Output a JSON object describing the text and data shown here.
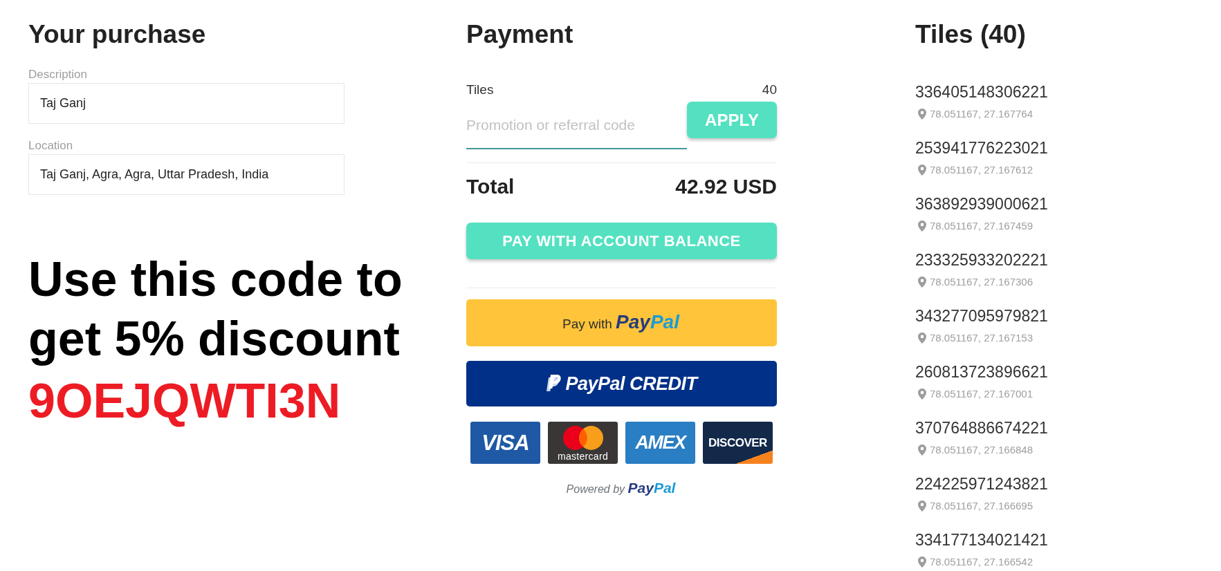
{
  "purchase": {
    "title": "Your purchase",
    "fields": [
      {
        "label": "Description",
        "value": "Taj Ganj"
      },
      {
        "label": "Location",
        "value": "Taj Ganj, Agra, Agra, Uttar Pradesh, India"
      }
    ]
  },
  "promo_banner": {
    "message": "Use this code to get 5% discount",
    "code": "9OEJQWTI3N"
  },
  "payment": {
    "title": "Payment",
    "summary": {
      "label": "Tiles",
      "value": "40"
    },
    "promo_field": {
      "placeholder": "Promotion or referral code"
    },
    "apply_button": "APPLY",
    "total": {
      "label": "Total",
      "value": "42.92 USD"
    },
    "balance_button": "PAY WITH ACCOUNT BALANCE",
    "paypal_button": "Pay with **PayPal**",
    "credit_button": "PayPal CREDIT",
    "cards": [
      {
        "kind": "visa",
        "label": "VISA"
      },
      {
        "kind": "mastercard",
        "label": "mastercard"
      },
      {
        "kind": "amex",
        "label": "AMEX"
      },
      {
        "kind": "discover",
        "label": "DISCOVER"
      }
    ],
    "powered_by": "Powered by **PayPal**"
  },
  "tiles": {
    "title": "Tiles (40)",
    "items": [
      {
        "id": "336405148306221",
        "coords": "78.051167, 27.167764"
      },
      {
        "id": "253941776223021",
        "coords": "78.051167, 27.167612"
      },
      {
        "id": "363892939000621",
        "coords": "78.051167, 27.167459"
      },
      {
        "id": "233325933202221",
        "coords": "78.051167, 27.167306"
      },
      {
        "id": "343277095979821",
        "coords": "78.051167, 27.167153"
      },
      {
        "id": "260813723896621",
        "coords": "78.051167, 27.167001"
      },
      {
        "id": "370764886674221",
        "coords": "78.051167, 27.166848"
      },
      {
        "id": "224225971243821",
        "coords": "78.051167, 27.166695"
      },
      {
        "id": "334177134021421",
        "coords": "78.051167, 27.166542"
      }
    ]
  }
}
